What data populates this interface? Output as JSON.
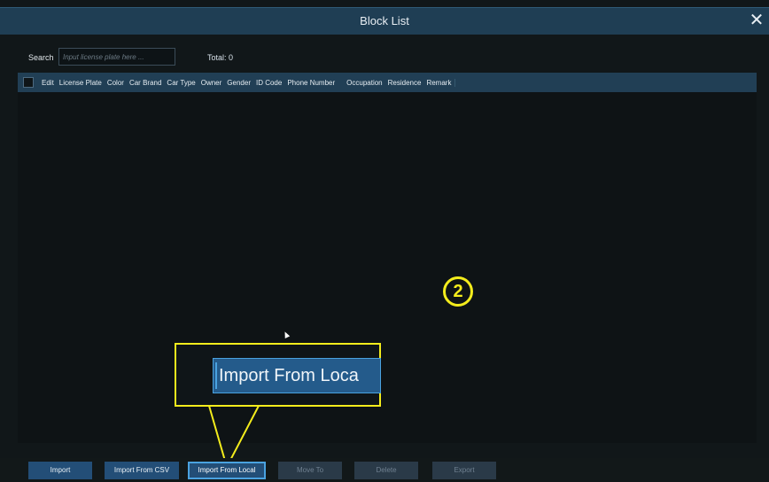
{
  "window": {
    "title": "Block List"
  },
  "search": {
    "label": "Search",
    "placeholder": "Input license plate here ..."
  },
  "total": {
    "text": "Total: 0"
  },
  "table": {
    "columns": [
      "Edit",
      "License Plate",
      "Color",
      "Car Brand",
      "Car Type",
      "Owner",
      "Gender",
      "ID Code",
      "Phone Number",
      "Occupation",
      "Residence",
      "Remark"
    ],
    "rows": []
  },
  "annotation": {
    "step_label": "2",
    "callout_text": "Import From Loca"
  },
  "toolbar": {
    "buttons": [
      {
        "label": "Import",
        "state": "enabled"
      },
      {
        "label": "Import From CSV",
        "state": "enabled"
      },
      {
        "label": "Import From Local",
        "state": "selected"
      },
      {
        "label": "Move To",
        "state": "disabled"
      },
      {
        "label": "Delete",
        "state": "disabled"
      },
      {
        "label": "Export",
        "state": "disabled"
      }
    ]
  },
  "colors": {
    "accent": "#234e77",
    "header": "#1f3e54",
    "highlight": "#f3ec1c"
  },
  "icons": {
    "close": "close-icon",
    "cursor": "mouse-pointer-icon"
  }
}
